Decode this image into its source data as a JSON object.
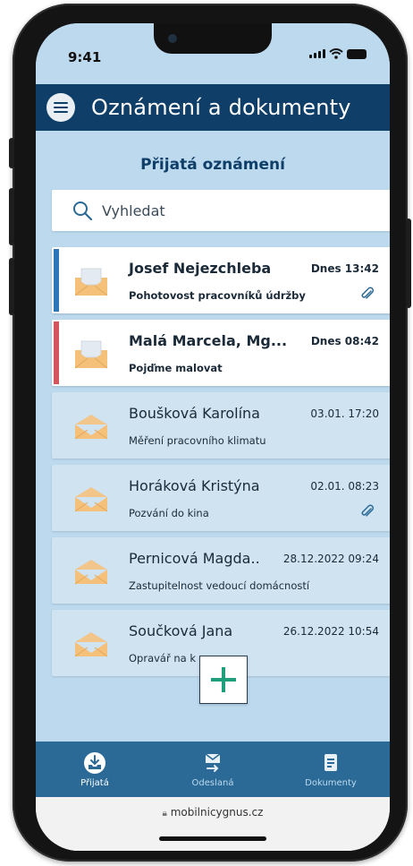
{
  "status_bar": {
    "time": "9:41"
  },
  "app_bar": {
    "title": "Oznámení a dokumenty",
    "menu_icon": "hamburger-menu-icon"
  },
  "section": {
    "title": "Přijatá oznámení"
  },
  "search": {
    "placeholder": "Vyhledat",
    "icon": "search-icon"
  },
  "messages": [
    {
      "sender": "Josef Nejezchleba",
      "datetime": "Dnes 13:42",
      "subject": "Pohotovost pracovníků údržby",
      "unread": true,
      "attachment": true,
      "accent": "#2d76b8"
    },
    {
      "sender": "Malá Marcela, Mg...",
      "datetime": "Dnes 08:42",
      "subject": "Pojďme malovat",
      "unread": true,
      "attachment": false,
      "accent": "#d4555c"
    },
    {
      "sender": "Boušková Karolína",
      "datetime": "03.01. 17:20",
      "subject": "Měření pracovního klimatu",
      "unread": false,
      "attachment": false
    },
    {
      "sender": "Horáková Kristýna",
      "datetime": "02.01. 08:23",
      "subject": "Pozvání do kina",
      "unread": false,
      "attachment": true
    },
    {
      "sender": "Pernicová Magda..",
      "datetime": "28.12.2022 09:24",
      "subject": "Zastupitelnost vedoucí domácností",
      "unread": false,
      "attachment": false
    },
    {
      "sender": "Součková Jana",
      "datetime": "26.12.2022 10:54",
      "subject": "Opravář na k",
      "unread": false,
      "attachment": false
    }
  ],
  "fab": {
    "icon": "plus-icon",
    "color": "#1f9e7c"
  },
  "bottom_nav": [
    {
      "label": "Přijatá",
      "icon": "inbox-download-icon",
      "active": true
    },
    {
      "label": "Odeslaná",
      "icon": "send-envelope-icon",
      "active": false
    },
    {
      "label": "Dokumenty",
      "icon": "document-icon",
      "active": false
    }
  ],
  "browser": {
    "url": "mobilnicygnus.cz"
  },
  "colors": {
    "primary": "#0f3e68",
    "background": "#bcd9ee",
    "nav": "#2b6a96",
    "envelope": "#f5c07a"
  }
}
